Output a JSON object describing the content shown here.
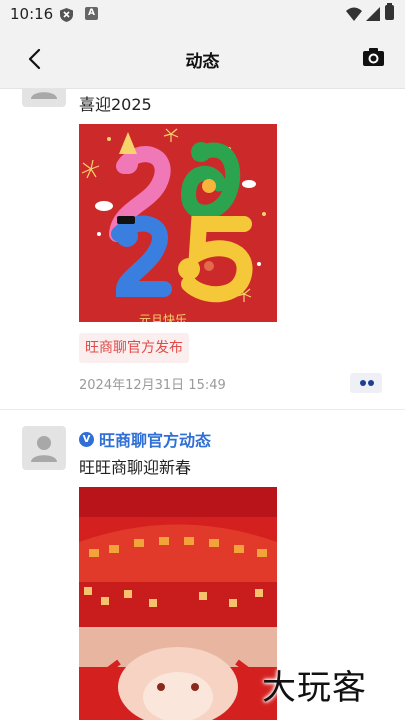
{
  "status_bar": {
    "time": "10:16",
    "icons": [
      "shield-icon",
      "a-badge-icon",
      "wifi-icon",
      "signal-icon",
      "battery-icon"
    ]
  },
  "header": {
    "title": "动态",
    "back_icon": "chevron-left-icon",
    "camera_icon": "camera-icon"
  },
  "posts": [
    {
      "text": "喜迎2025",
      "image_caption": "元旦快乐",
      "tag": "旺商聊官方发布",
      "timestamp": "2024年12月31日 15:49"
    },
    {
      "author": "旺商聊官方动态",
      "verified_badge": "V",
      "text": "旺旺商聊迎新春"
    }
  ],
  "watermark": "大玩客",
  "colors": {
    "accent_blue": "#2f6fd6",
    "tag_red": "#e14a4a",
    "tag_bg": "#fbeeee",
    "header_bg": "#f2f2f2"
  }
}
